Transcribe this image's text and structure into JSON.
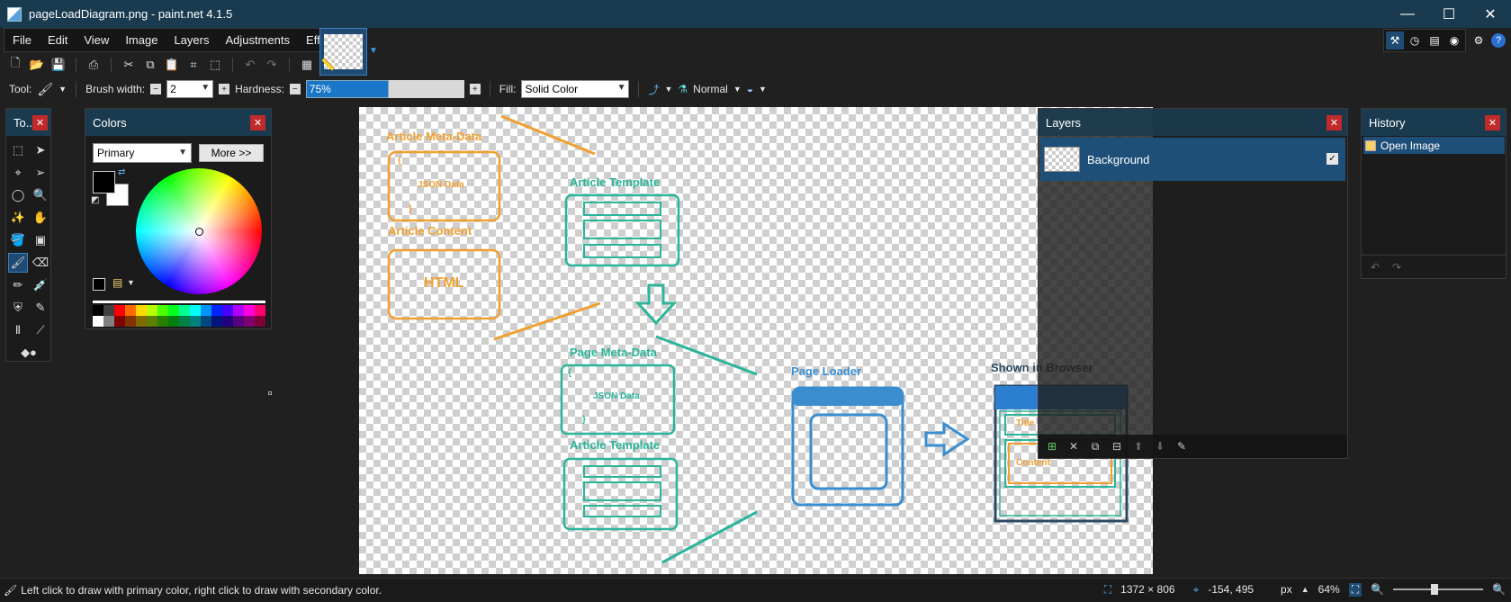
{
  "window": {
    "title": "pageLoadDiagram.png - paint.net 4.1.5",
    "minimize": "—",
    "maximize": "☐",
    "close": "✕"
  },
  "menu": [
    "File",
    "Edit",
    "View",
    "Image",
    "Layers",
    "Adjustments",
    "Effects"
  ],
  "options": {
    "tool_label": "Tool:",
    "brush_width_label": "Brush width:",
    "brush_width_value": "2",
    "hardness_label": "Hardness:",
    "hardness_value": "75%",
    "hardness_fraction": 0.75,
    "fill_label": "Fill:",
    "fill_value": "Solid Color",
    "blend_mode": "Normal"
  },
  "tools_panel": {
    "title": "To..."
  },
  "colors_panel": {
    "title": "Colors",
    "mode": "Primary",
    "more_button": "More >>",
    "primary_color": "#000000",
    "secondary_color": "#ffffff",
    "palette_top": [
      "#000000",
      "#404040",
      "#ff0000",
      "#ff6a00",
      "#ffd800",
      "#b6ff00",
      "#4cff00",
      "#00ff21",
      "#00ff90",
      "#00ffff",
      "#0094ff",
      "#0026ff",
      "#4800ff",
      "#b200ff",
      "#ff00dc",
      "#ff006e"
    ],
    "palette_bottom": [
      "#ffffff",
      "#808080",
      "#7f0000",
      "#7f3300",
      "#7f6a00",
      "#5b7f00",
      "#267f00",
      "#007f0e",
      "#007f46",
      "#007f7f",
      "#004a7f",
      "#00137f",
      "#21007f",
      "#57007f",
      "#7f006e",
      "#7f0037"
    ]
  },
  "layers_panel": {
    "title": "Layers",
    "layers": [
      {
        "name": "Background",
        "visible": true
      }
    ]
  },
  "history_panel": {
    "title": "History",
    "items": [
      "Open Image"
    ]
  },
  "canvas_diagram": {
    "article_meta_title": "Article Meta-Data",
    "article_meta_brace_open": "{",
    "article_meta_json": "JSON Data",
    "article_meta_brace_close": "}",
    "article_content_title": "Article Content",
    "article_content_html": "HTML",
    "article_template_top": "Article Template",
    "page_meta_title": "Page Meta-Data",
    "page_meta_brace_open": "{",
    "page_meta_json": "JSON Data",
    "page_meta_brace_close": "}",
    "article_template_bottom": "Article Template",
    "page_loader": "Page Loader",
    "shown_in_browser": "Shown in Browser",
    "browser_title": "Title",
    "browser_content": "Content",
    "colors": {
      "orange": "#f0a030",
      "teal": "#2bb59a",
      "blue": "#3a8ed0",
      "dark": "#2c4a64"
    }
  },
  "statusbar": {
    "message": "Left click to draw with primary color, right click to draw with secondary color.",
    "image_size": "1372 × 806",
    "cursor_position": "-154, 495",
    "units": "px",
    "zoom": "64%"
  }
}
